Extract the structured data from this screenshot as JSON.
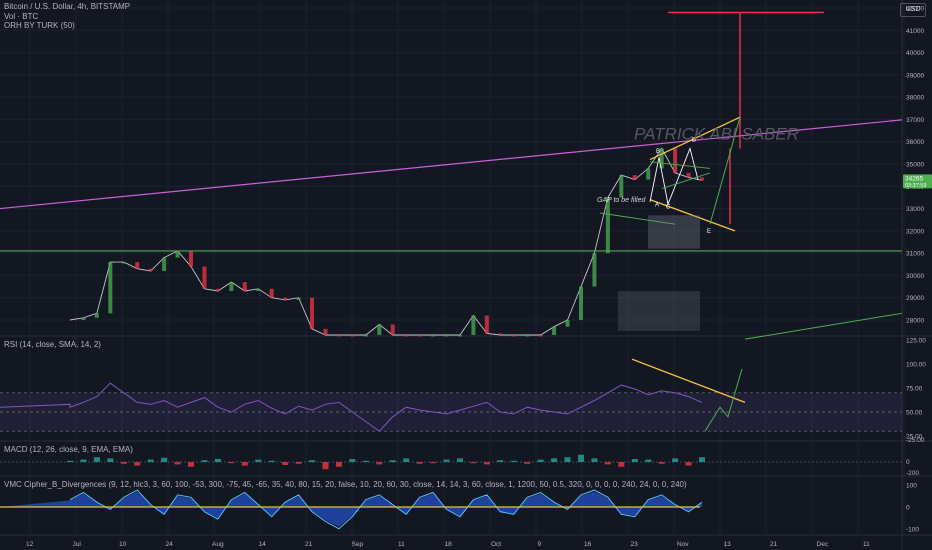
{
  "header": {
    "title": "Bitcoin / U.S. Dollar, 4h, BITSTAMP",
    "volume": "Vol · BTC",
    "indicator": "ORH BY TURK (50)",
    "currency": "USD"
  },
  "watermark": "PATRICK ABI SABER",
  "annotations": {
    "gap": "GAP to be filled",
    "wave_a": "A",
    "wave_b": "B",
    "wave_c": "C",
    "wave_d": "D",
    "wave_e": "E"
  },
  "price_tag": {
    "value": "34265",
    "countdown": "03:37:59"
  },
  "panes": {
    "rsi": {
      "label": "RSI (14, close, SMA, 14, 2)",
      "ticks": [
        "125.00",
        "100.00",
        "75.00",
        "50.00",
        "25.00"
      ]
    },
    "macd": {
      "label": "MACD (12, 26, close, 9, EMA, EMA)",
      "ticks": [
        "-25.00",
        "0",
        "-200"
      ]
    },
    "cipher": {
      "label": "VMC Cipher_B_Divergences (9, 12, hlc3, 3, 60, 100, -53, 300, -75, 45, -65, 35, 40, 80, 15, 20, false, 10, 20, 60, 30, close, 14, 14, 3, 60, close, 1, 1200, 50, 0.5, 320, 0, 0, 0, 0, 240, 24, 0, 0, 240)",
      "ticks": [
        "100",
        "0",
        "-100"
      ]
    }
  },
  "chart_data": [
    {
      "type": "line",
      "title": "Bitcoin / U.S. Dollar, 4h, BITSTAMP",
      "y_axis_ticks": [
        "42000",
        "41000",
        "40000",
        "39000",
        "38000",
        "37000",
        "36000",
        "35000",
        "34000",
        "33000",
        "32000",
        "31000",
        "30000",
        "29000",
        "28000"
      ],
      "x_axis_ticks": [
        "12",
        "Jul",
        "10",
        "24",
        "Aug",
        "14",
        "21",
        "Sep",
        "11",
        "18",
        "Oct",
        "9",
        "16",
        "23",
        "Nov",
        "13",
        "21",
        "Dec",
        "11"
      ],
      "ylim": [
        27500,
        42500
      ],
      "series": [
        {
          "points": [
            [
              0,
              28000
            ],
            [
              1,
              28100
            ],
            [
              2,
              28300
            ],
            [
              3,
              30600
            ],
            [
              4,
              30600
            ],
            [
              5,
              30300
            ],
            [
              6,
              30200
            ],
            [
              7,
              30800
            ],
            [
              8,
              31100
            ],
            [
              9,
              30400
            ],
            [
              10,
              29400
            ],
            [
              11,
              29300
            ],
            [
              12,
              29700
            ],
            [
              13,
              29300
            ],
            [
              14,
              29400
            ],
            [
              15,
              29000
            ],
            [
              16,
              28900
            ],
            [
              17,
              29000
            ],
            [
              18,
              27600
            ],
            [
              19,
              27000
            ],
            [
              20,
              26200
            ],
            [
              21,
              26000
            ],
            [
              22,
              26100
            ],
            [
              23,
              27800
            ],
            [
              24,
              26800
            ],
            [
              25,
              26300
            ],
            [
              26,
              25800
            ],
            [
              27,
              26300
            ],
            [
              28,
              26500
            ],
            [
              29,
              27200
            ],
            [
              30,
              28200
            ],
            [
              31,
              27400
            ],
            [
              32,
              26900
            ],
            [
              33,
              26500
            ],
            [
              34,
              26900
            ],
            [
              35,
              26800
            ],
            [
              36,
              27700
            ],
            [
              37,
              28000
            ],
            [
              38,
              29500
            ],
            [
              39,
              31000
            ],
            [
              40,
              33500
            ],
            [
              41,
              34500
            ],
            [
              42,
              34300
            ],
            [
              43,
              34800
            ],
            [
              44,
              35700
            ],
            [
              45,
              34600
            ],
            [
              46,
              34400
            ],
            [
              47,
              34265
            ]
          ]
        }
      ],
      "lines": {
        "upper_trend": [
          33000,
          36800
        ],
        "horizontal_support": 31100,
        "target_level": 41800,
        "lower_trend": [
          27500,
          28300
        ]
      }
    },
    {
      "type": "line",
      "title": "RSI (14, close, SMA, 14, 2)",
      "ylim": [
        25,
        125
      ],
      "bands": [
        30,
        50,
        70
      ],
      "series": [
        {
          "values": [
            55,
            60,
            66,
            80,
            70,
            60,
            58,
            62,
            55,
            60,
            65,
            55,
            50,
            58,
            62,
            54,
            48,
            56,
            52,
            58,
            60,
            50,
            40,
            30,
            45,
            55,
            52,
            50,
            48,
            52,
            56,
            60,
            50,
            48,
            55,
            52,
            50,
            48,
            55,
            62,
            70,
            78,
            74,
            68,
            72,
            70,
            66,
            60
          ]
        }
      ]
    },
    {
      "type": "bar",
      "title": "MACD (12, 26, close, 9, EMA, EMA)",
      "ylim": [
        -300,
        150
      ],
      "series": [
        {
          "values": [
            20,
            40,
            80,
            60,
            -30,
            -60,
            40,
            70,
            -40,
            -80,
            30,
            50,
            -20,
            -60,
            40,
            20,
            -50,
            -30,
            30,
            -120,
            -80,
            50,
            20,
            -40,
            30,
            60,
            -30,
            -20,
            40,
            60,
            -20,
            -40,
            30,
            20,
            -30,
            40,
            60,
            80,
            120,
            60,
            -40,
            -80,
            50,
            40,
            -30,
            60,
            -60,
            80
          ]
        }
      ]
    },
    {
      "type": "area",
      "title": "VMC Cipher_B_Divergences",
      "ylim": [
        -120,
        120
      ],
      "series": [
        {
          "values": [
            30,
            60,
            20,
            -10,
            40,
            70,
            10,
            -30,
            50,
            40,
            -20,
            -50,
            30,
            60,
            10,
            -40,
            20,
            50,
            -20,
            -60,
            -90,
            -40,
            30,
            50,
            10,
            -30,
            40,
            60,
            -10,
            -40,
            30,
            50,
            -20,
            -30,
            40,
            60,
            20,
            -10,
            50,
            70,
            40,
            -30,
            -40,
            30,
            50,
            10,
            -20,
            20
          ]
        }
      ]
    }
  ]
}
